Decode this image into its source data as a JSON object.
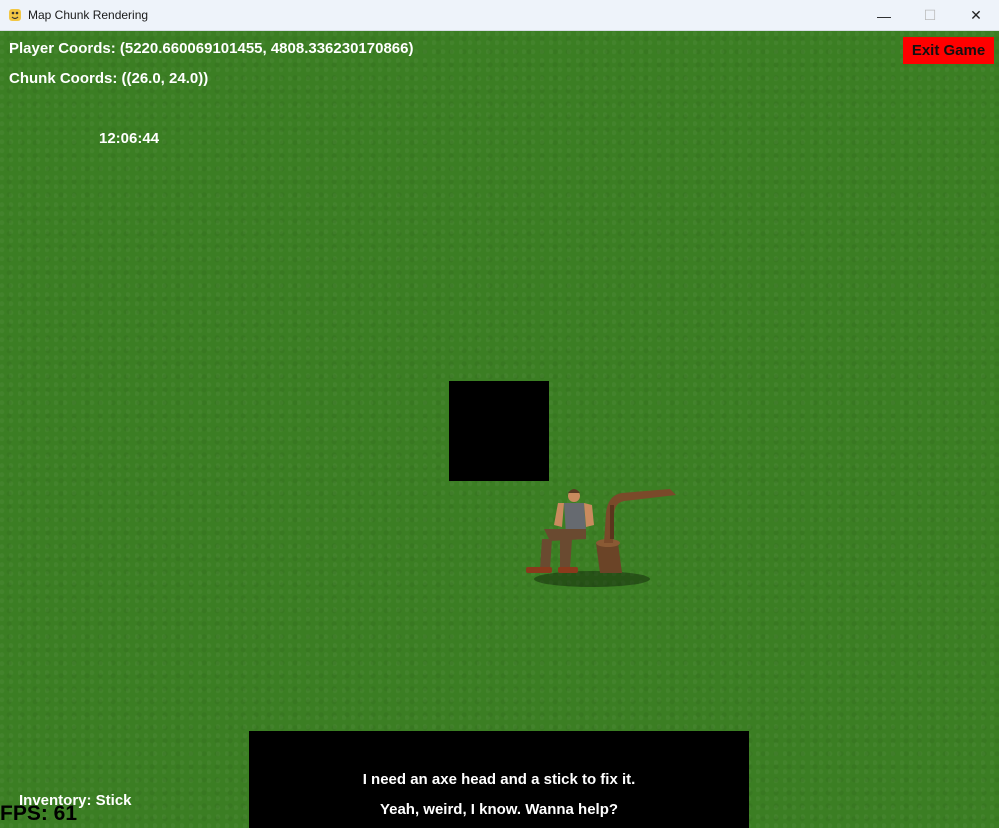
{
  "window": {
    "title": "Map Chunk Rendering",
    "icon": "pygame-snake-icon",
    "controls": {
      "minimize": "—",
      "maximize": "☐",
      "close": "✕"
    }
  },
  "hud": {
    "player_coords": "Player Coords: (5220.660069101455, 4808.336230170866)",
    "chunk_coords": "Chunk Coords: ((26.0, 24.0))",
    "clock": "12:06:44",
    "inventory": "Inventory: Stick",
    "fps": "FPS: 61"
  },
  "exit_button": {
    "label": "Exit Game",
    "color": "#ff0000"
  },
  "dialog": {
    "lines": [
      "I need an axe head and a stick to fix it.",
      "Yeah, weird, I know. Wanna help?"
    ]
  },
  "npc": {
    "icon": "lumberjack-npc-sprite"
  },
  "colors": {
    "grass": "#3b7e23",
    "hud_text": "#ffffff",
    "dialog_bg": "#000000"
  }
}
